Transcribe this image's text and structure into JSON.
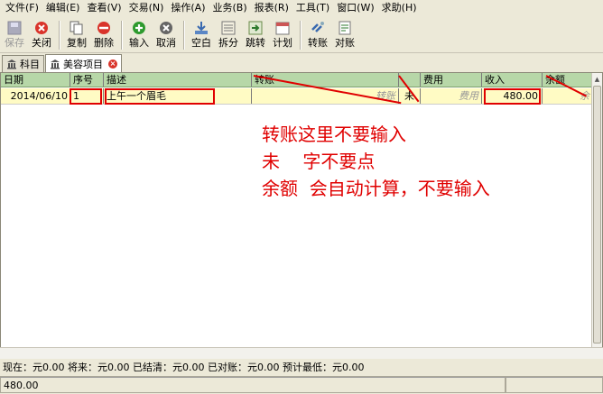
{
  "menu": [
    "文件(F)",
    "编辑(E)",
    "查看(V)",
    "交易(N)",
    "操作(A)",
    "业务(B)",
    "报表(R)",
    "工具(T)",
    "窗口(W)",
    "求助(H)"
  ],
  "toolbar": {
    "save": "保存",
    "close": "关闭",
    "copy": "复制",
    "delete": "删除",
    "enter": "输入",
    "cancel": "取消",
    "blank": "空白",
    "split": "拆分",
    "jump": "跳转",
    "schedule": "计划",
    "transfer": "转账",
    "reconcile": "对账"
  },
  "tabs": [
    {
      "label": "科目"
    },
    {
      "label": "美容项目"
    }
  ],
  "columns": {
    "date": "日期",
    "num": "序号",
    "desc": "描述",
    "transfer": "转账",
    "reconciled": "",
    "expense": "费用",
    "income": "收入",
    "balance": "余额"
  },
  "row": {
    "date": "2014/06/10",
    "num": "1",
    "desc": "上午一个眉毛",
    "transfer_placeholder": "转账",
    "reconciled": "未",
    "expense_placeholder": "费用",
    "income": "480.00",
    "balance_placeholder": "余"
  },
  "annotation": {
    "line1": "转账这里不要输入",
    "line2": "未    字不要点",
    "line3": "余额  会自动计算，不要输入"
  },
  "summary": "现在：元0.00  将来：元0.00  已结清：元0.00  已对账：元0.00  预计最低：元0.00",
  "status": {
    "value": "480.00"
  },
  "colors": {
    "annotation": "#e00000",
    "header": "#b7d7a8",
    "row": "#fffbc4"
  }
}
